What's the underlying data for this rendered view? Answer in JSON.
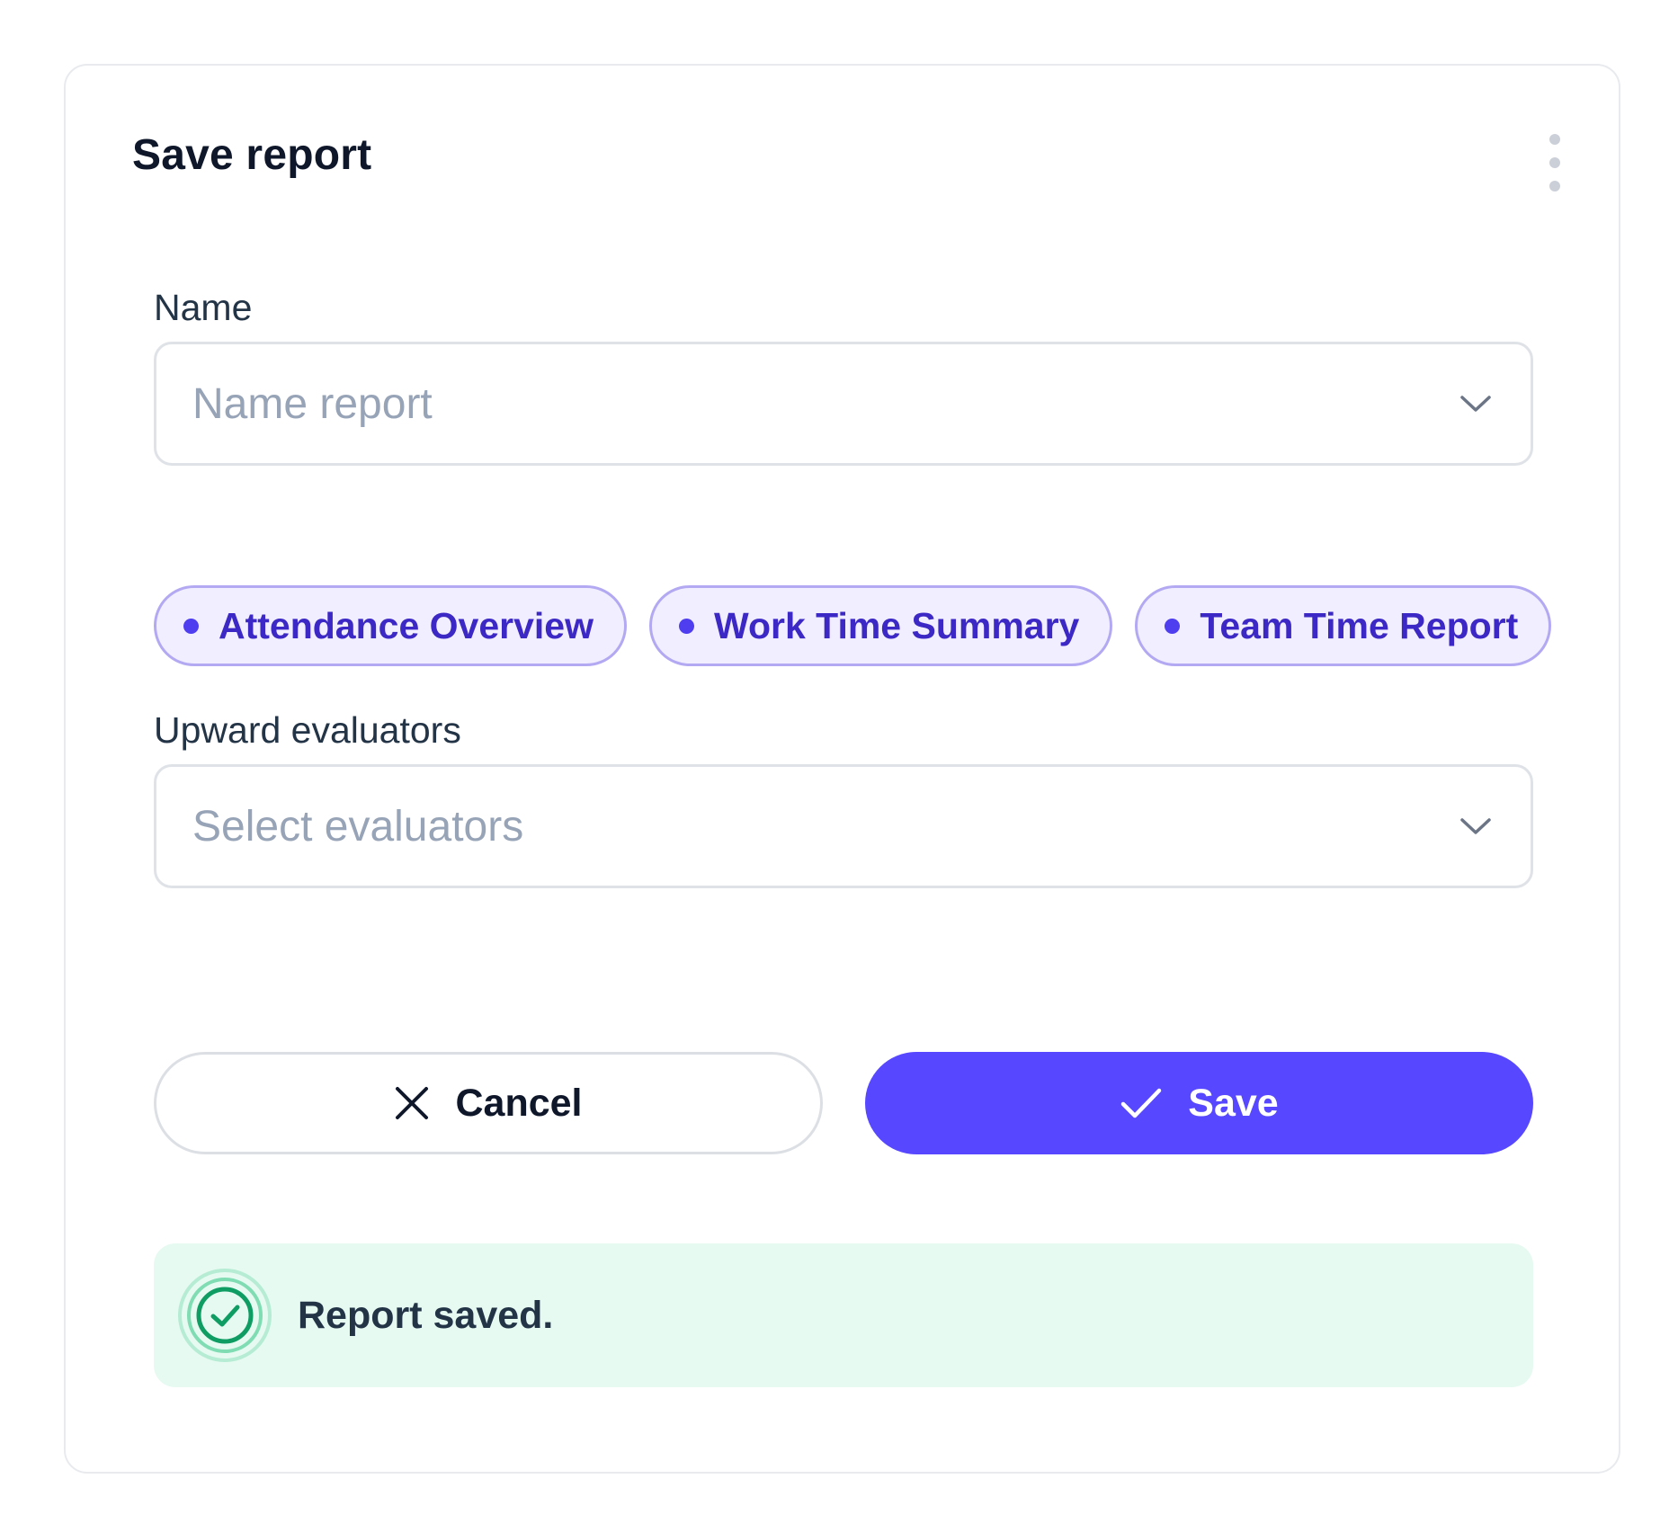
{
  "dialog": {
    "title": "Save report",
    "menu_icon": "kebab-vertical-icon"
  },
  "name_field": {
    "label": "Name",
    "placeholder": "Name report",
    "icon": "chevron-down-icon"
  },
  "chips": [
    {
      "label": "Attendance Overview"
    },
    {
      "label": "Work Time Summary"
    },
    {
      "label": "Team Time Report"
    }
  ],
  "evaluators_field": {
    "label": "Upward evaluators",
    "placeholder": "Select evaluators",
    "icon": "chevron-down-icon"
  },
  "actions": {
    "cancel_label": "Cancel",
    "cancel_icon": "close-icon",
    "save_label": "Save",
    "save_icon": "check-icon"
  },
  "toast": {
    "message": "Report saved.",
    "icon": "success-check-circle-icon"
  },
  "colors": {
    "accent": "#5748ff",
    "chip_bg": "#f1efff",
    "chip_border": "#b3a9f3",
    "chip_text": "#3c28c4",
    "success_bg": "#e6faf1",
    "success_icon": "#0f9d63"
  }
}
